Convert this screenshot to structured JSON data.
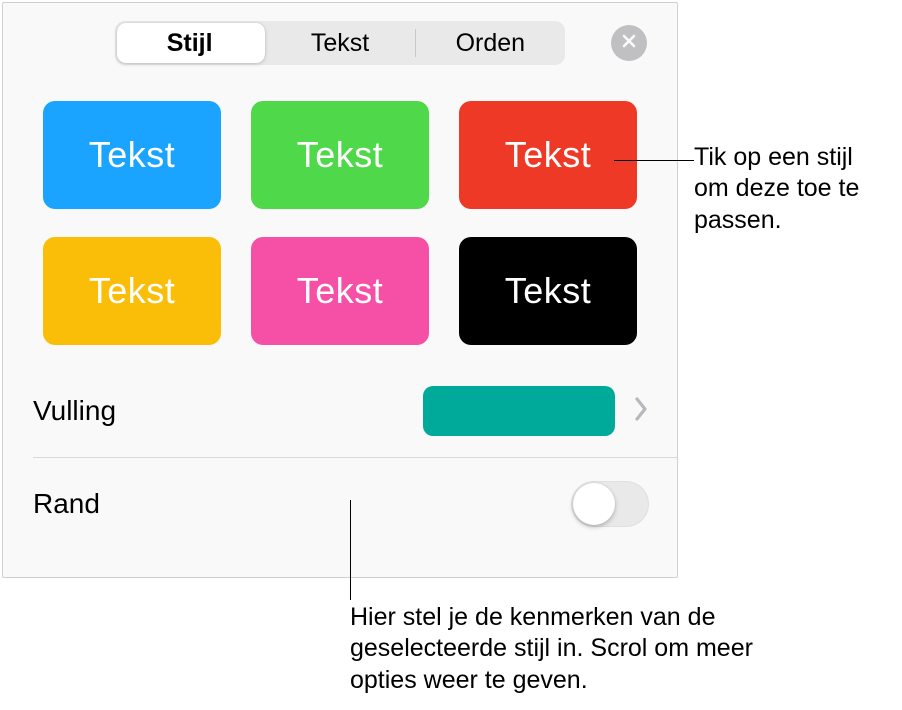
{
  "tabs": {
    "style": "Stijl",
    "text": "Tekst",
    "arrange": "Orden"
  },
  "swatch_label": "Tekst",
  "swatch_colors": [
    "#1aa4ff",
    "#4fd84a",
    "#ef3927",
    "#fabd08",
    "#f550a6",
    "#000000"
  ],
  "fill": {
    "label": "Vulling",
    "color": "#00aa9a"
  },
  "border": {
    "label": "Rand",
    "on": false
  },
  "callouts": {
    "right": "Tik op een stijl om deze toe te passen.",
    "bottom": "Hier stel je de kenmerken van de geselecteerde stijl in. Scrol om meer opties weer te geven."
  }
}
